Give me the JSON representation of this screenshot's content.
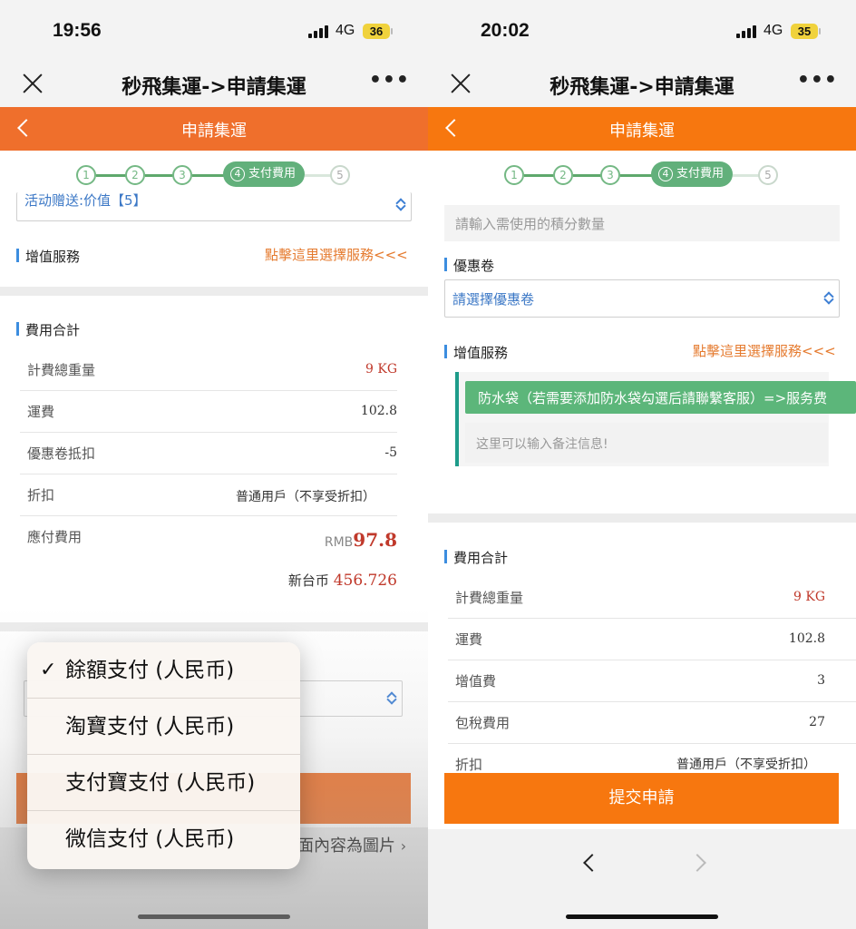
{
  "left": {
    "status": {
      "time": "19:56",
      "network": "4G",
      "battery": "36"
    },
    "titlebar": {
      "title": "秒飛集運->申請集運"
    },
    "header": {
      "title": "申請集運"
    },
    "steps": [
      "1",
      "2",
      "3",
      "支付費用",
      "5"
    ],
    "active_step_num": "4",
    "promo_select": "活动赠送:价值【5】",
    "value_added": {
      "title": "增值服務",
      "link": "點擊這里選擇服務<<<"
    },
    "fees": {
      "title": "費用合計",
      "rows": [
        {
          "label": "計費總重量",
          "value": "9 KG"
        },
        {
          "label": "運費",
          "value": "102.8"
        },
        {
          "label": "優惠卷抵扣",
          "value": "-5"
        },
        {
          "label": "折扣",
          "value": "普通用戶（不享受折扣）"
        }
      ],
      "payable_label": "應付費用",
      "payable_currency": "RMB",
      "payable_amount": "97.8",
      "ntd_label": "新台币",
      "ntd_amount": "456.726"
    },
    "popup": {
      "items": [
        "餘額支付 (人民币)",
        "淘寶支付 (人民币)",
        "支付寶支付 (人民币)",
        "微信支付 (人民币)"
      ],
      "selected_index": 0
    },
    "note": "面內容為圖片"
  },
  "right": {
    "status": {
      "time": "20:02",
      "network": "4G",
      "battery": "35"
    },
    "titlebar": {
      "title": "秒飛集運->申請集運"
    },
    "header": {
      "title": "申請集運"
    },
    "steps": [
      "1",
      "2",
      "3",
      "支付費用",
      "5"
    ],
    "active_step_num": "4",
    "points_placeholder": "請輸入需使用的積分數量",
    "coupon": {
      "title": "優惠卷",
      "placeholder": "請選擇優惠卷"
    },
    "value_added": {
      "title": "增值服務",
      "link": "點擊這里選擇服務<<<",
      "selected_service": "防水袋（若需要添加防水袋勾選后請聯繫客服）=>服务费",
      "note_placeholder": "这里可以输入备注信息!"
    },
    "fees": {
      "title": "費用合計",
      "rows": [
        {
          "label": "計費總重量",
          "value": "9 KG"
        },
        {
          "label": "運費",
          "value": "102.8"
        },
        {
          "label": "增值費",
          "value": "3"
        },
        {
          "label": "包稅費用",
          "value": "27"
        },
        {
          "label": "折扣",
          "value": "普通用戶（不享受折扣）"
        }
      ]
    },
    "submit": "提交申請"
  }
}
